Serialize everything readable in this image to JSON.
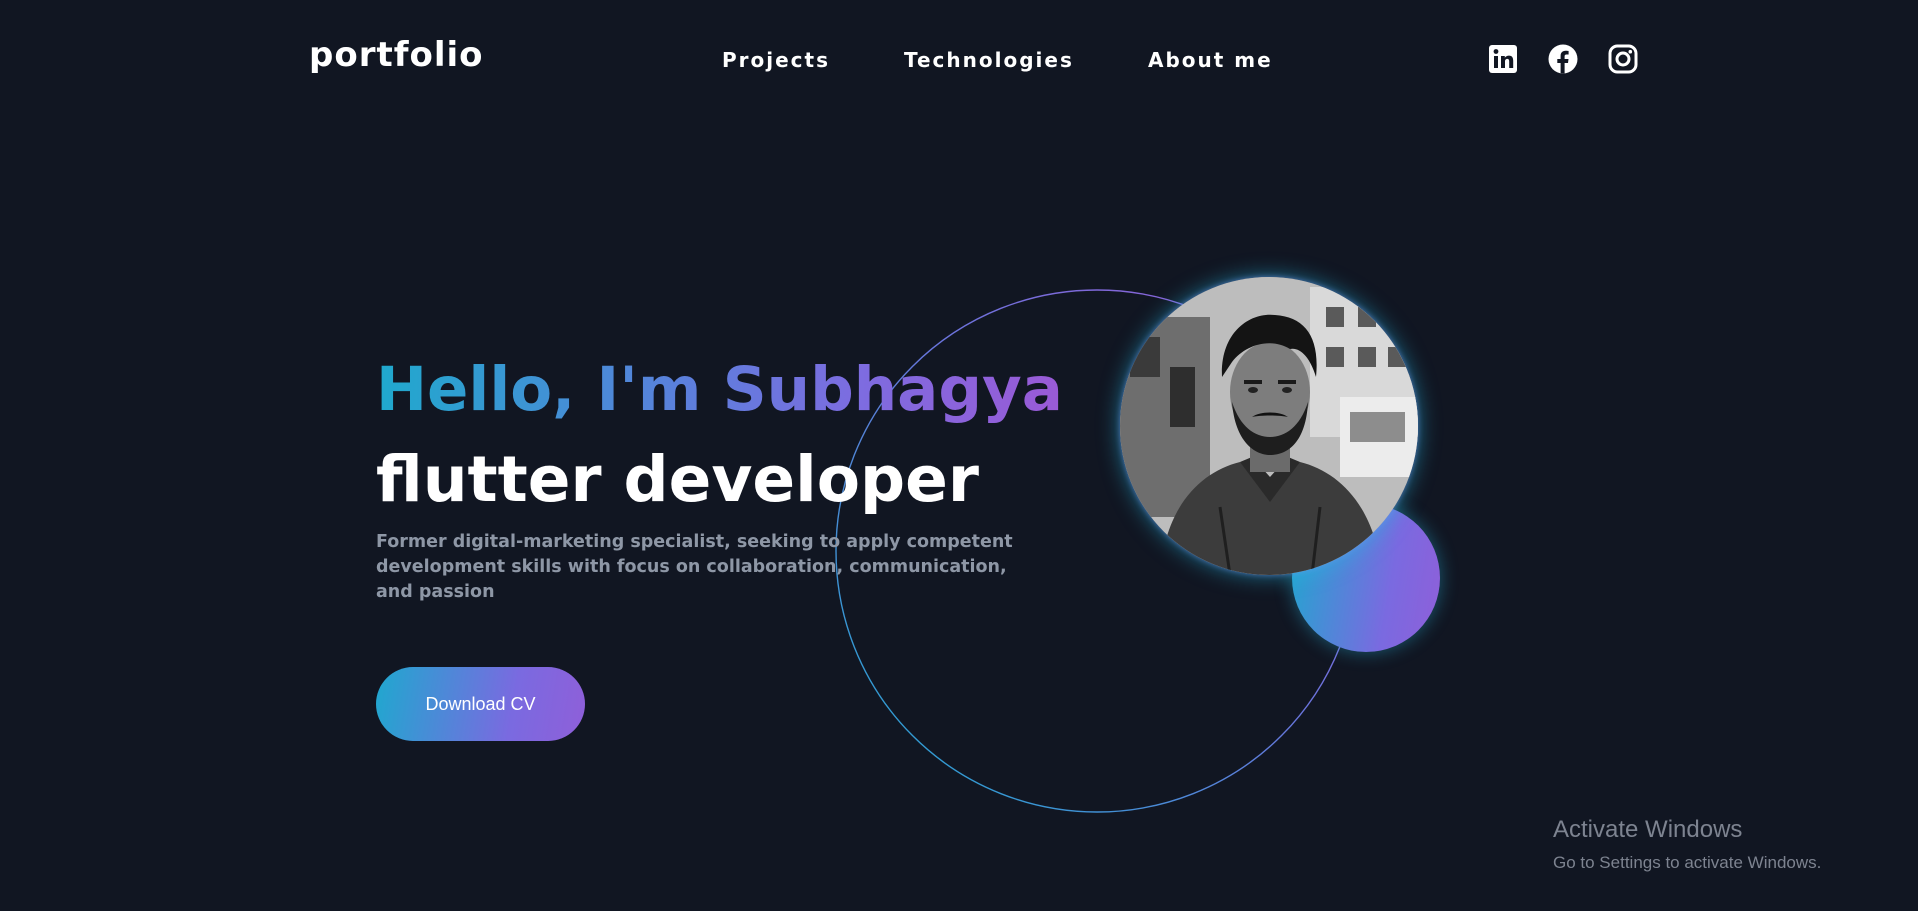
{
  "header": {
    "logo": "portfolio",
    "nav": [
      {
        "label": "Projects"
      },
      {
        "label": "Technologies"
      },
      {
        "label": "About me"
      }
    ],
    "socials": [
      "linkedin-icon",
      "facebook-icon",
      "instagram-icon"
    ]
  },
  "hero": {
    "greeting": "Hello, I'm Subhagya",
    "role": "flutter developer",
    "tagline": "Former digital-marketing specialist, seeking to apply competent development skills with focus on collaboration, communication, and passion",
    "cta_label": "Download CV"
  },
  "watermark": {
    "title": "Activate Windows",
    "subtitle": "Go to Settings to activate Windows."
  },
  "colors": {
    "background": "#111622",
    "accent_start": "#1fa8cf",
    "accent_end": "#8f5fd9",
    "text_primary": "#ffffff",
    "text_muted": "#8e97a6"
  }
}
